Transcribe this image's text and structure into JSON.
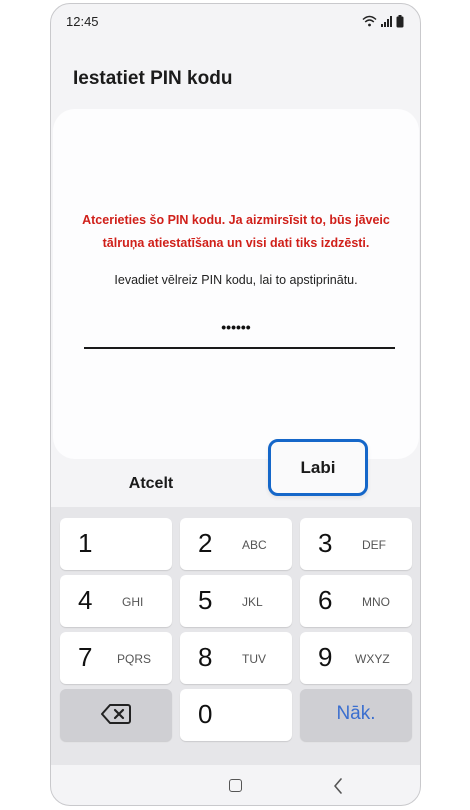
{
  "status": {
    "time": "12:45",
    "icons": [
      "wifi-icon",
      "signal-icon",
      "battery-icon"
    ]
  },
  "screen": {
    "title": "Iestatiet PIN kodu",
    "warning_line1": "Atcerieties šo PIN kodu. Ja aizmirsīsit to, būs jāveic",
    "warning_line2": "tālruņa atiestatīšana un visi dati tiks izdzēsti.",
    "instruction": "Ievadiet vēlreiz PIN kodu, lai to apstiprinātu.",
    "pin_masked": "••••••"
  },
  "actions": {
    "cancel_label": "Atcelt",
    "ok_label": "Labi"
  },
  "keypad": {
    "keys": [
      {
        "num": "1",
        "letters": ""
      },
      {
        "num": "2",
        "letters": "ABC"
      },
      {
        "num": "3",
        "letters": "DEF"
      },
      {
        "num": "4",
        "letters": "GHI"
      },
      {
        "num": "5",
        "letters": "JKL"
      },
      {
        "num": "6",
        "letters": "MNO"
      },
      {
        "num": "7",
        "letters": "PQRS"
      },
      {
        "num": "8",
        "letters": "TUV"
      },
      {
        "num": "9",
        "letters": "WXYZ"
      },
      {
        "num": "0",
        "letters": ""
      }
    ],
    "next_label": "Nāk.",
    "backspace_icon": "backspace-icon"
  },
  "nav": {
    "home_icon": "home-icon",
    "back_icon": "back-icon"
  },
  "colors": {
    "warning": "#d0201a",
    "accent": "#1567c9",
    "next_text": "#3b6fcf"
  }
}
